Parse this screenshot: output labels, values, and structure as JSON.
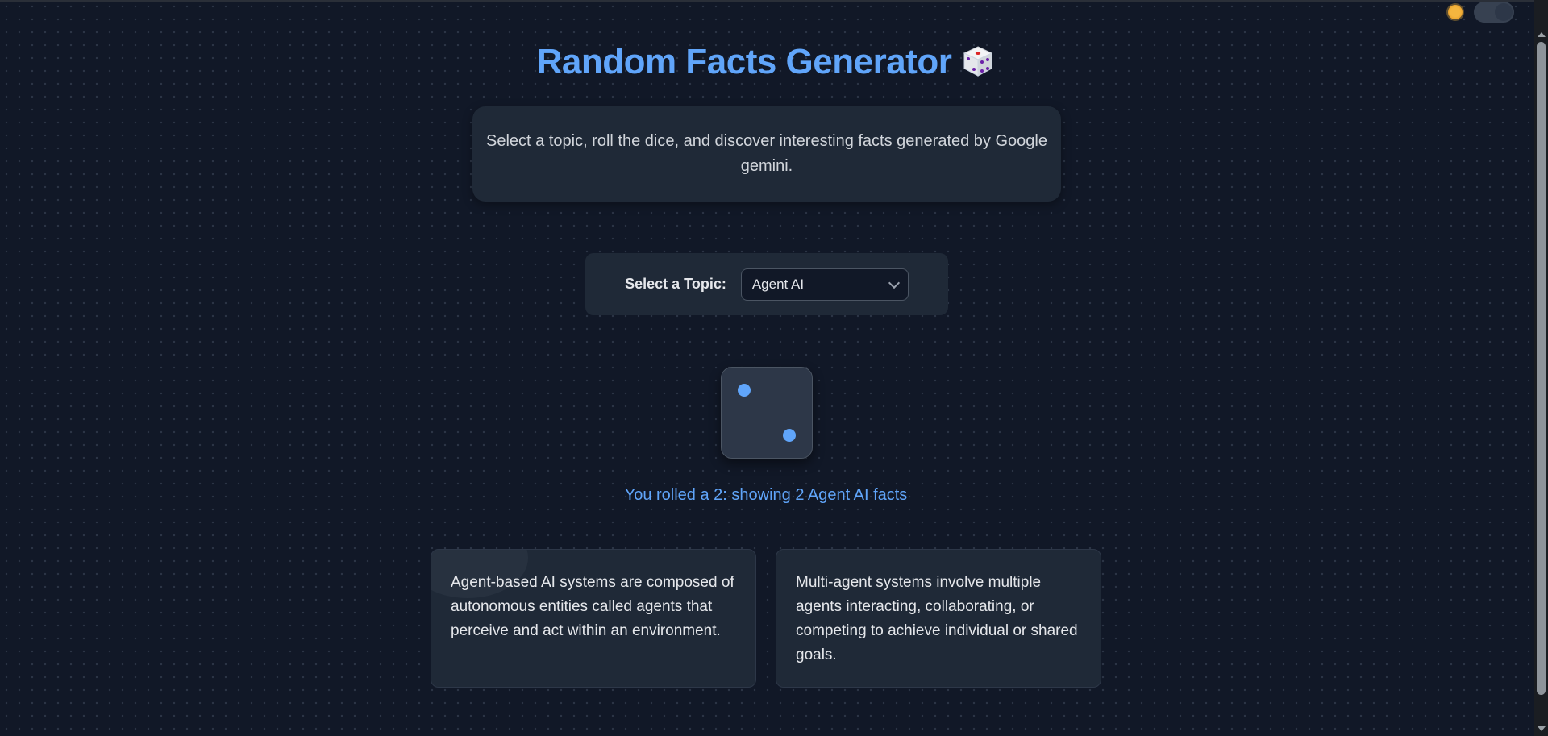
{
  "header": {
    "title": "Random Facts Generator",
    "title_emoji": "dice-icon"
  },
  "intro": {
    "text": "Select a topic, roll the dice, and discover interesting facts generated by Google gemini."
  },
  "topic_selector": {
    "label": "Select a Topic:",
    "selected": "Agent AI"
  },
  "die": {
    "value": 2
  },
  "result": {
    "text": "You rolled a 2: showing 2 Agent AI facts"
  },
  "facts": [
    {
      "text": "Agent-based AI systems are composed of autonomous entities called agents that perceive and act within an environment."
    },
    {
      "text": "Multi-agent systems involve multiple agents interacting, collaborating, or competing to achieve individual or shared goals."
    }
  ],
  "theme_toggle": {
    "icon": "sun-icon",
    "state": "dark"
  },
  "colors": {
    "accent": "#60a5fa",
    "background": "#111827",
    "card": "#1f2937"
  }
}
